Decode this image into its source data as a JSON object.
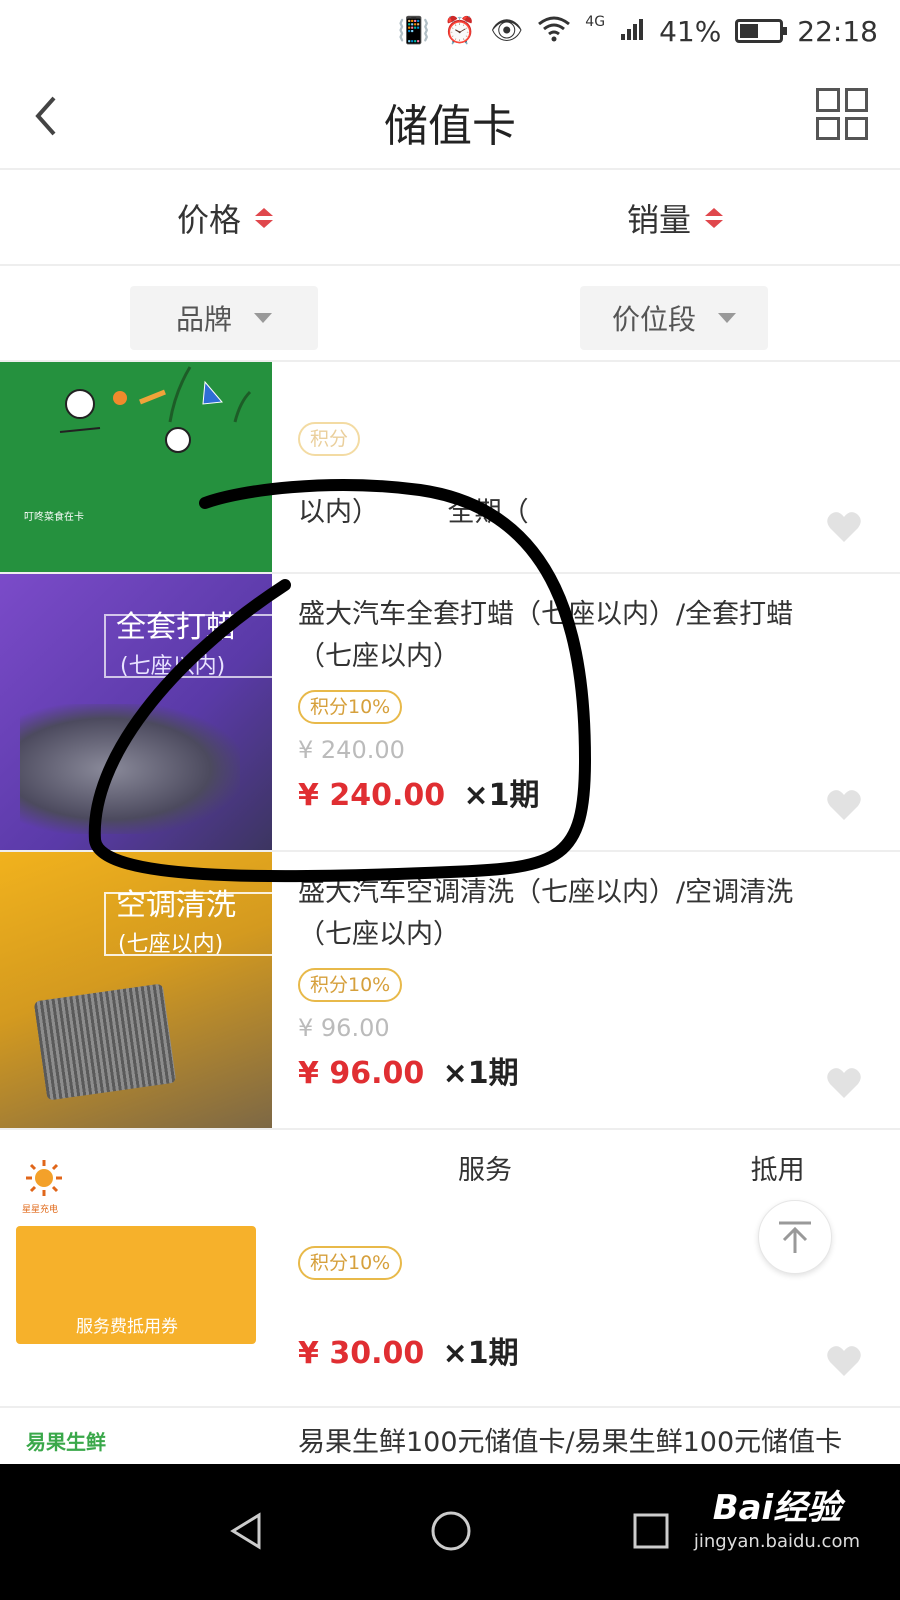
{
  "status_bar": {
    "battery": "41%",
    "time": "22:18",
    "network": "4G",
    "battery_level": 0.41
  },
  "header": {
    "title": "储值卡"
  },
  "sort_bar": {
    "items": [
      {
        "label": "价格"
      },
      {
        "label": "销量"
      }
    ]
  },
  "filter_bar": {
    "brand_label": "品牌",
    "price_range_label": "价位段"
  },
  "products": [
    {
      "name": "以内）",
      "name_tail": "全期（",
      "badge": "积分",
      "thumb_caption": "叮咚菜食在卡"
    },
    {
      "name": "盛大汽车全套打蜡（七座以内）/全套打蜡（七座以内）",
      "badge": "积分10%",
      "original_price": "¥ 240.00",
      "price": "¥ 240.00",
      "period": "×1期",
      "thumb_title": "全套打蜡",
      "thumb_subtitle": "(七座以内)"
    },
    {
      "name": "盛大汽车空调清洗（七座以内）/空调清洗（七座以内）",
      "badge": "积分10%",
      "original_price": "¥ 96.00",
      "price": "¥ 96.00",
      "period": "×1期",
      "thumb_title": "空调清洗",
      "thumb_subtitle": "(七座以内)"
    },
    {
      "name": "服务",
      "name_tail": "抵用",
      "badge": "积分10%",
      "price": "¥ 30.00",
      "period": "×1期",
      "thumb_logo_text": "星星充电",
      "thumb_caption": "服务费抵用券"
    },
    {
      "name": "易果生鲜100元储值卡/易果生鲜100元储值卡",
      "logo_text": "易果生鲜"
    }
  ],
  "watermark": {
    "line1": "Bai经验",
    "line2": "jingyan.baidu.com"
  },
  "colors": {
    "price_red": "#e02e32",
    "badge_gold": "#d6a03c",
    "sort_arrow_red": "#e0474c"
  }
}
